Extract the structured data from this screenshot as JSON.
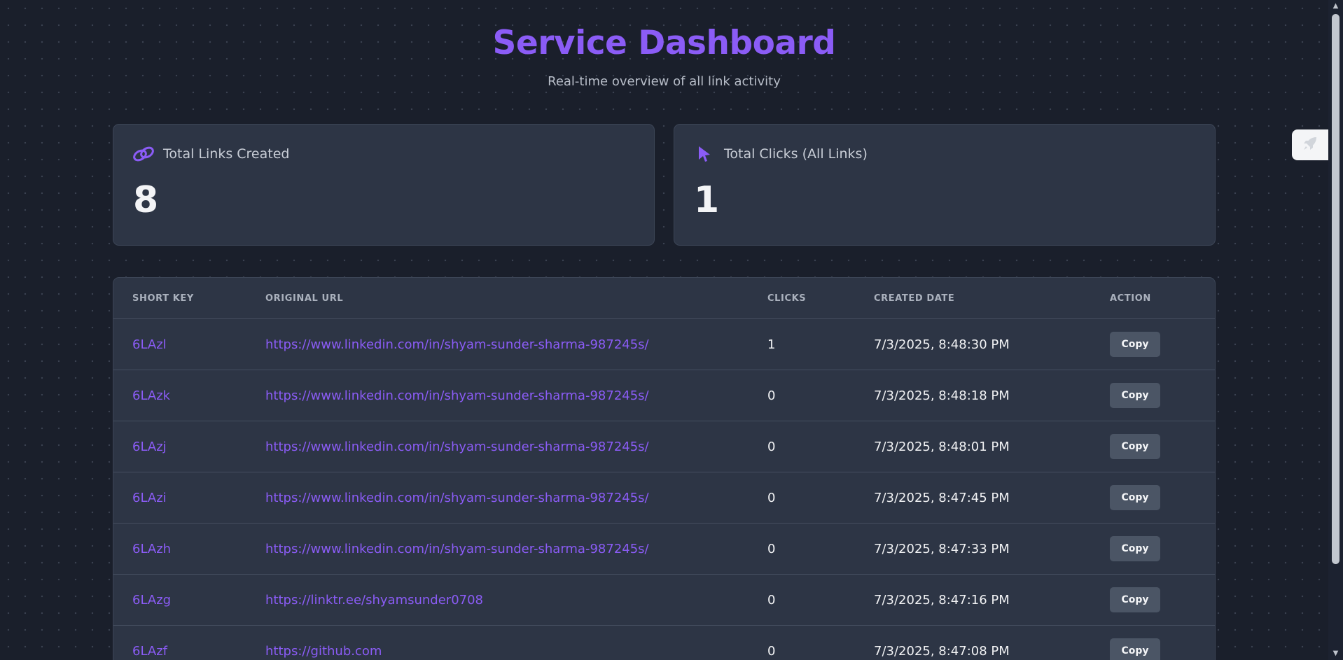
{
  "header": {
    "title": "Service Dashboard",
    "subtitle": "Real-time overview of all link activity"
  },
  "stats": {
    "links": {
      "icon": "link-icon",
      "label": "Total Links Created",
      "value": "8"
    },
    "clicks": {
      "icon": "cursor-icon",
      "label": "Total Clicks (All Links)",
      "value": "1"
    }
  },
  "side_tab": {
    "icon": "rocket-icon"
  },
  "table": {
    "columns": [
      "SHORT KEY",
      "ORIGINAL URL",
      "CLICKS",
      "CREATED DATE",
      "ACTION"
    ],
    "rows": [
      {
        "key": "6LAzl",
        "url": "https://www.linkedin.com/in/shyam-sunder-sharma-987245s/",
        "clicks": "1",
        "date": "7/3/2025, 8:48:30 PM",
        "action": "Copy"
      },
      {
        "key": "6LAzk",
        "url": "https://www.linkedin.com/in/shyam-sunder-sharma-987245s/",
        "clicks": "0",
        "date": "7/3/2025, 8:48:18 PM",
        "action": "Copy"
      },
      {
        "key": "6LAzj",
        "url": "https://www.linkedin.com/in/shyam-sunder-sharma-987245s/",
        "clicks": "0",
        "date": "7/3/2025, 8:48:01 PM",
        "action": "Copy"
      },
      {
        "key": "6LAzi",
        "url": "https://www.linkedin.com/in/shyam-sunder-sharma-987245s/",
        "clicks": "0",
        "date": "7/3/2025, 8:47:45 PM",
        "action": "Copy"
      },
      {
        "key": "6LAzh",
        "url": "https://www.linkedin.com/in/shyam-sunder-sharma-987245s/",
        "clicks": "0",
        "date": "7/3/2025, 8:47:33 PM",
        "action": "Copy"
      },
      {
        "key": "6LAzg",
        "url": "https://linktr.ee/shyamsunder0708",
        "clicks": "0",
        "date": "7/3/2025, 8:47:16 PM",
        "action": "Copy"
      },
      {
        "key": "6LAzf",
        "url": "https://github.com",
        "clicks": "0",
        "date": "7/3/2025, 8:47:08 PM",
        "action": "Copy"
      }
    ]
  },
  "colors": {
    "accent": "#8b5cf6",
    "background": "#1a1f2b",
    "card": "#2d3545"
  }
}
